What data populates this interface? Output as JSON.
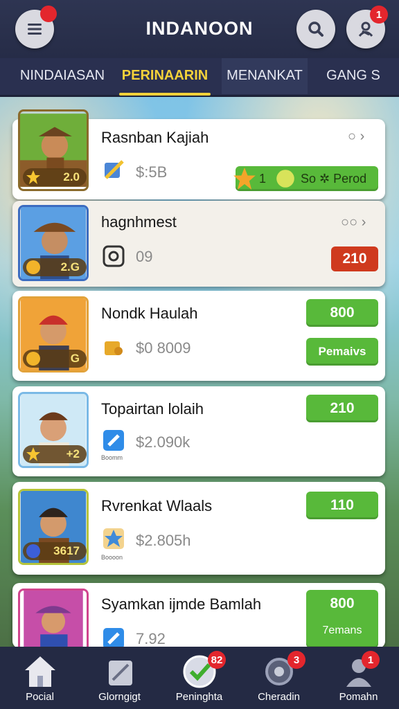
{
  "header": {
    "title": "INDANOON",
    "menu_badge": "",
    "profile_badge": "1"
  },
  "tabs": [
    {
      "label": "NINDAIASAN"
    },
    {
      "label": "PERINAARIN"
    },
    {
      "label": "MENANKAT"
    },
    {
      "label": "GANG S"
    }
  ],
  "items": [
    {
      "name": "Rasnban Kajiah",
      "level": "2.0",
      "value": "$:5B",
      "action_label": "1",
      "action_text": "So ✲ Perod",
      "more": "○ ›"
    },
    {
      "name": "hagnhmest",
      "level": "2.G",
      "value": "09",
      "action_label": "210",
      "more": "○○ ›"
    },
    {
      "name": "Nondk Haulah",
      "level": "G",
      "value": "$0 8009",
      "action_label": "800",
      "secondary_label": "Pemaivs"
    },
    {
      "name": "Topairtan lolaih",
      "level": "+2",
      "value": "$2.090k",
      "caption": "Boomm",
      "action_label": "210"
    },
    {
      "name": "Rvrenkat Wlaals",
      "level": "3617",
      "value": "$2.805h",
      "caption": "Boooon",
      "action_label": "110"
    },
    {
      "name": "Syamkan ijmde Bamlah",
      "level": "",
      "value": "7.92",
      "action_label": "800",
      "secondary_label": "7emans"
    }
  ],
  "bottom_nav": [
    {
      "label": "Pocial",
      "badge": ""
    },
    {
      "label": "Glorngigt",
      "badge": ""
    },
    {
      "label": "Peninghta",
      "badge": "82"
    },
    {
      "label": "Cheradin",
      "badge": "3"
    },
    {
      "label": "Pomahn",
      "badge": "1"
    }
  ],
  "colors": {
    "accent": "#f4d23a",
    "green": "#58b93a",
    "red": "#cf3a1e",
    "header": "#2a3050"
  }
}
